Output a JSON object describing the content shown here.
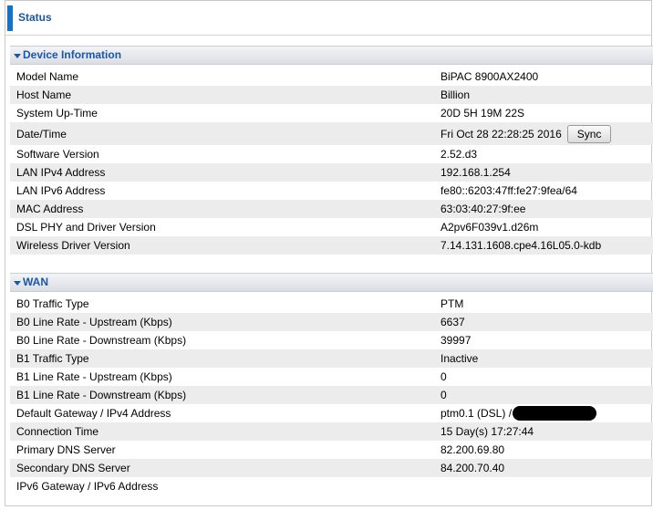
{
  "page": {
    "title": "Status"
  },
  "device_info": {
    "title": "Device Information",
    "sync_label": "Sync",
    "rows": [
      {
        "label": "Model Name",
        "value": "BiPAC 8900AX2400"
      },
      {
        "label": "Host Name",
        "value": "Billion"
      },
      {
        "label": "System Up-Time",
        "value": "20D 5H 19M 22S"
      },
      {
        "label": "Date/Time",
        "value": "Fri Oct 28 22:28:25 2016"
      },
      {
        "label": "Software Version",
        "value": "2.52.d3"
      },
      {
        "label": "LAN IPv4 Address",
        "value": "192.168.1.254"
      },
      {
        "label": "LAN IPv6 Address",
        "value": "fe80::6203:47ff:fe27:9fea/64"
      },
      {
        "label": "MAC Address",
        "value": "63:03:40:27:9f:ee"
      },
      {
        "label": "DSL PHY and Driver Version",
        "value": "A2pv6F039v1.d26m"
      },
      {
        "label": "Wireless Driver Version",
        "value": "7.14.131.1608.cpe4.16L05.0-kdb"
      }
    ]
  },
  "wan": {
    "title": "WAN",
    "rows": [
      {
        "label": "B0 Traffic Type",
        "value": "PTM"
      },
      {
        "label": "B0 Line Rate - Upstream (Kbps)",
        "value": "6637"
      },
      {
        "label": "B0 Line Rate - Downstream (Kbps)",
        "value": "39997"
      },
      {
        "label": "B1 Traffic Type",
        "value": "Inactive"
      },
      {
        "label": "B1 Line Rate - Upstream (Kbps)",
        "value": "0"
      },
      {
        "label": "B1 Line Rate - Downstream (Kbps)",
        "value": "0"
      },
      {
        "label": "Default Gateway / IPv4 Address",
        "value": "ptm0.1 (DSL) /"
      },
      {
        "label": "Connection Time",
        "value": "15 Day(s) 17:27:44"
      },
      {
        "label": "Primary DNS Server",
        "value": "82.200.69.80"
      },
      {
        "label": "Secondary DNS Server",
        "value": "84.200.70.40"
      },
      {
        "label": "IPv6 Gateway / IPv6 Address",
        "value": ""
      }
    ]
  }
}
